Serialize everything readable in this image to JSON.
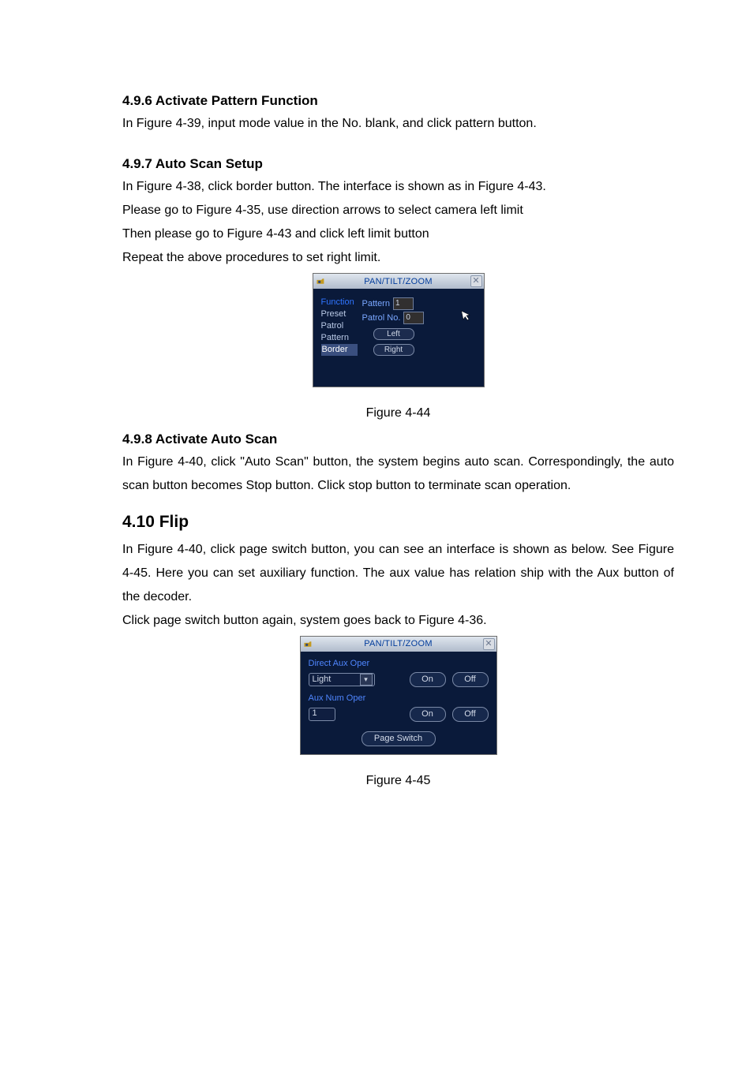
{
  "sections": {
    "s1": {
      "heading": "4.9.6 Activate Pattern Function",
      "p1": "In  Figure 4-39, input mode value in the No. blank, and click pattern button."
    },
    "s2": {
      "heading": "4.9.7 Auto Scan Setup",
      "p1": "In  Figure 4-38, click border button. The interface is shown as in  Figure 4-43.",
      "p2": "Please go to  Figure 4-35, use direction arrows to select camera left limit",
      "p3": "Then please go to  Figure 4-43 and click left limit button",
      "p4": "Repeat the above procedures to set right limit."
    },
    "caption1": "Figure 4-44",
    "s3": {
      "heading": "4.9.8 Activate Auto Scan",
      "p1": "In Figure 4-40, click \"Auto Scan\" button, the system begins auto scan. Correspondingly, the auto scan button becomes Stop button. Click stop button to terminate scan operation."
    },
    "s4": {
      "heading": "4.10  Flip",
      "p1": "In Figure 4-40, click page switch button, you can see an interface is shown as below. See Figure 4-45. Here you can set auxiliary function. The aux value has relation ship with the Aux button of the decoder.",
      "p2": "Click page switch button again, system goes back to Figure 4-36."
    },
    "caption2": "Figure 4-45"
  },
  "dialog1": {
    "title": "PAN/TILT/ZOOM",
    "func_head": "Function",
    "items": {
      "preset": "Preset",
      "patrol": "Patrol",
      "pattern": "Pattern",
      "border": "Border"
    },
    "labels": {
      "pattern": "Pattern",
      "patrol_no": "Patrol No."
    },
    "values": {
      "pattern": "1",
      "patrol_no": "0"
    },
    "buttons": {
      "left": "Left",
      "right": "Right"
    }
  },
  "dialog2": {
    "title": "PAN/TILT/ZOOM",
    "sections": {
      "direct": "Direct Aux Oper",
      "auxnum": "Aux Num Oper"
    },
    "select_value": "Light",
    "num_value": "1",
    "buttons": {
      "on": "On",
      "off": "Off",
      "page_switch": "Page Switch"
    }
  }
}
